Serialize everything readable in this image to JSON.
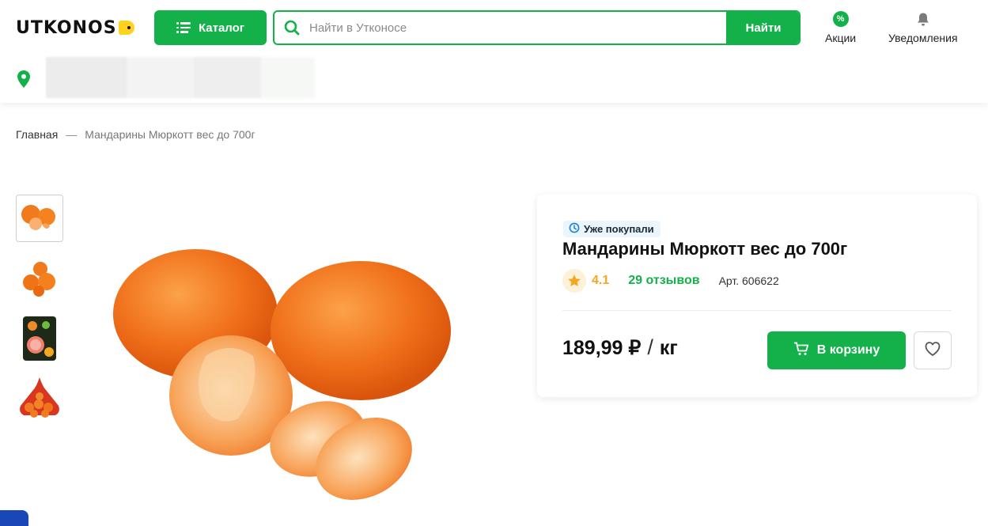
{
  "header": {
    "logo_text": "UTKONOS",
    "catalog_label": "Каталог",
    "search_placeholder": "Найти в Утконосе",
    "search_button": "Найти",
    "promo_label": "Акции",
    "notifications_label": "Уведомления"
  },
  "breadcrumb": {
    "home": "Главная",
    "separator": "—",
    "current": "Мандарины Мюркотт вес до 700г"
  },
  "product": {
    "badge": "Уже покупали",
    "title": "Мандарины Мюркотт вес до 700г",
    "rating": "4.1",
    "reviews": "29 отзывов",
    "article": "Арт. 606622",
    "price": "189,99 ₽",
    "price_slash": "/",
    "unit": "кг",
    "cart_button": "В корзину"
  },
  "thumbnails": [
    "thumb-mandarins-peeled",
    "thumb-mandarins-pile",
    "thumb-package-photo",
    "thumb-mandarins-net"
  ],
  "colors": {
    "brand_green": "#14b14b",
    "logo_yellow": "#ffd21f",
    "rating_orange": "#f5a623"
  }
}
